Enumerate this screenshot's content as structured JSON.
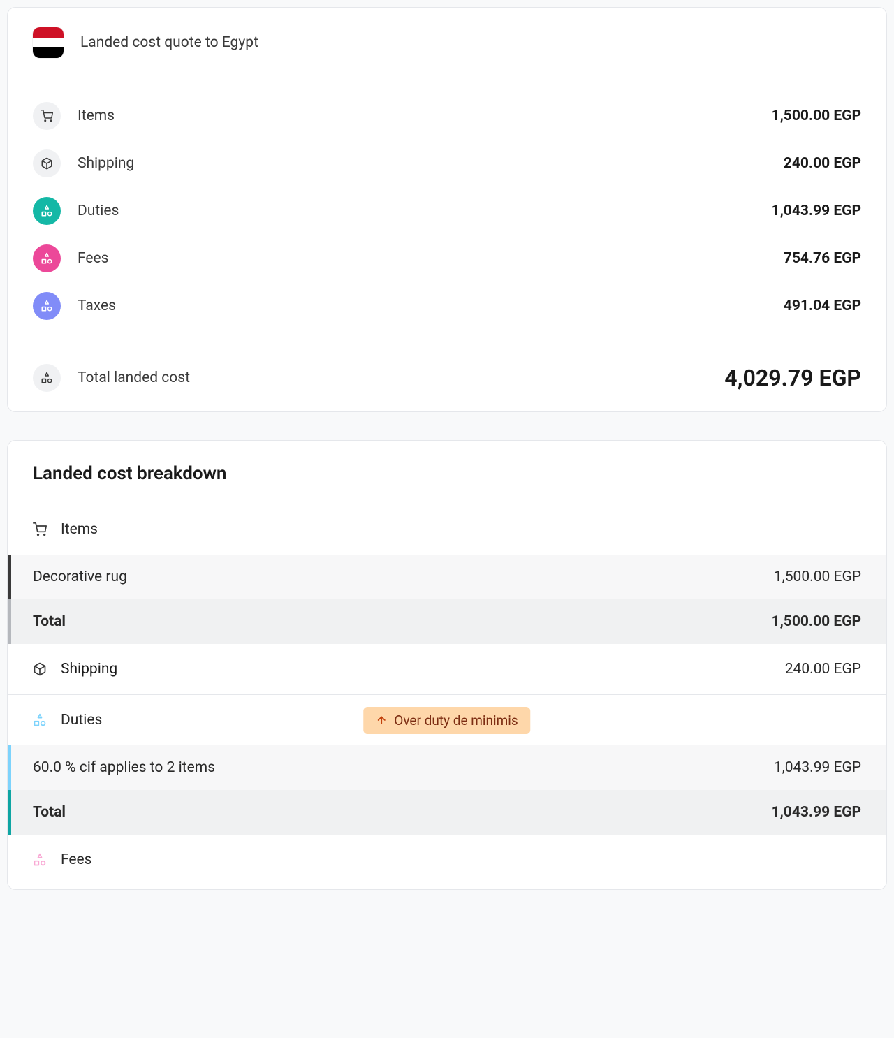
{
  "summary": {
    "title": "Landed cost quote to Egypt",
    "rows": {
      "items": {
        "label": "Items",
        "value": "1,500.00 EGP"
      },
      "shipping": {
        "label": "Shipping",
        "value": "240.00 EGP"
      },
      "duties": {
        "label": "Duties",
        "value": "1,043.99 EGP"
      },
      "fees": {
        "label": "Fees",
        "value": "754.76 EGP"
      },
      "taxes": {
        "label": "Taxes",
        "value": "491.04 EGP"
      }
    },
    "total": {
      "label": "Total landed cost",
      "value": "4,029.79 EGP"
    }
  },
  "breakdown": {
    "title": "Landed cost breakdown",
    "items_header": "Items",
    "item_row": {
      "label": "Decorative rug",
      "value": "1,500.00 EGP"
    },
    "items_total": {
      "label": "Total",
      "value": "1,500.00 EGP"
    },
    "shipping_header": "Shipping",
    "shipping_value": "240.00 EGP",
    "duties_header": "Duties",
    "duties_badge": "Over duty de minimis",
    "duties_row": {
      "label": "60.0 % cif applies to 2 items",
      "value": "1,043.99 EGP"
    },
    "duties_total": {
      "label": "Total",
      "value": "1,043.99 EGP"
    },
    "fees_header": "Fees"
  }
}
